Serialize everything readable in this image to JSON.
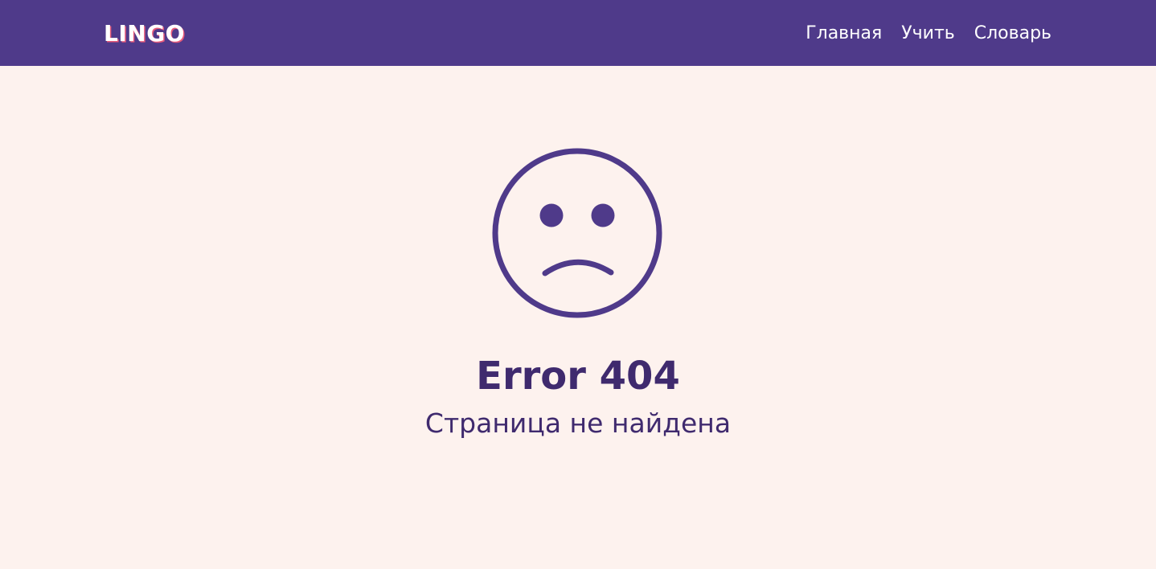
{
  "header": {
    "logo": "LINGO",
    "nav": {
      "home": "Главная",
      "learn": "Учить",
      "dictionary": "Словарь"
    }
  },
  "main": {
    "icon": "sad-face-icon",
    "title": "Error 404",
    "subtitle": "Страница не найдена"
  },
  "colors": {
    "header_bg": "#4f3a8a",
    "page_bg": "#fdf2ee",
    "text_accent": "#3f2a6e",
    "icon": "#4f3a8a",
    "logo_shadow": "#e85a7a"
  }
}
